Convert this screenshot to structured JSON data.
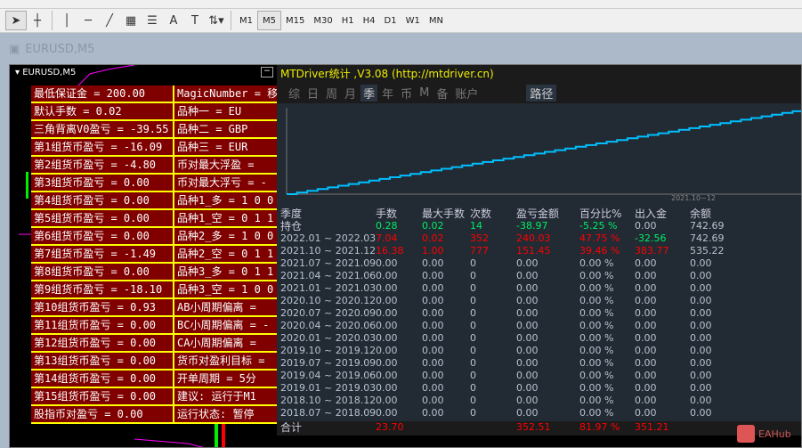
{
  "toolbar": {
    "timeframes": [
      "M1",
      "M5",
      "M15",
      "M30",
      "H1",
      "H4",
      "D1",
      "W1",
      "MN"
    ],
    "active_tf": "M5"
  },
  "window": {
    "title": "EURUSD,M5"
  },
  "chart": {
    "symbol": "EURUSD,M5",
    "minimize": "−"
  },
  "panel": {
    "left": [
      "最低保证金   =  200.00",
      "  默认手数       =  0.02",
      "三角背离V0盈亏 = -39.55",
      "第1组货币盈亏 =  -16.09",
      "第2组货币盈亏 =  -4.80",
      " 第3组货币盈亏 =  0.00",
      " 第4组货币盈亏 =  0.00",
      " 第5组货币盈亏 =  0.00",
      " 第6组货币盈亏 =  0.00",
      "第7组货币盈亏 =  -1.49",
      " 第8组货币盈亏 =  0.00",
      "第9组货币盈亏 =  -18.10",
      " 第10组货币盈亏 = 0.93",
      " 第11组货币盈亏 = 0.00",
      " 第12组货币盈亏 = 0.00",
      " 第13组货币盈亏 = 0.00",
      " 第14组货币盈亏 = 0.00",
      " 第15组货币盈亏 = 0.00",
      "  股指币对盈亏 = 0.00"
    ],
    "right": [
      "MagicNumber = 移",
      "  品种一 =   EU",
      "  品种二 =   GBP",
      "  品种三 =   EUR",
      " 币对最大浮盈 = ",
      " 币对最大浮亏 = -",
      " 品种1_多 = 1 0 0",
      " 品种1_空 = 0 1 1",
      " 品种2_多 = 1 0 0",
      " 品种2_空 = 0 1 1",
      " 品种3_多 = 0 1 1",
      " 品种3_空 = 1 0 0",
      "  AB小周期偏离 = ",
      "  BC小周期偏离 = -",
      "  CA小周期偏离 = ",
      "货币对盈利目标 = ",
      "   开单周期 =  5分",
      "   建议: 运行于M1",
      "  运行状态: 暂停"
    ]
  },
  "stats": {
    "title": "MTDriver统计 ,V3.08 (http://mtdriver.cn)",
    "tabs": [
      "综",
      "日",
      "周",
      "月",
      "季",
      "年",
      "币",
      "M",
      "备",
      "账户"
    ],
    "active_tab": "季",
    "path": "路径",
    "equity_date": "2021.10~12",
    "headers": [
      "季度",
      "手数",
      "最大手数",
      "次数",
      "盈亏金额",
      "百分比%",
      "出入金",
      "余额"
    ],
    "rows": [
      {
        "c": [
          "持仓",
          "0.28",
          "0.02",
          "14",
          "-38.97",
          "-5.25 %",
          "0.00",
          "742.69"
        ],
        "k": [
          "",
          "g",
          "g",
          "g",
          "g",
          "g",
          "",
          ""
        ]
      },
      {
        "c": [
          "2022.01 ~ 2022.03",
          "7.04",
          "0.02",
          "352",
          "240.03",
          "47.75 %",
          "-32.56",
          "742.69"
        ],
        "k": [
          "",
          "r",
          "r",
          "r",
          "r",
          "r",
          "g",
          ""
        ]
      },
      {
        "c": [
          "2021.10 ~ 2021.12",
          "16.38",
          "1.00",
          "777",
          "151.45",
          "39.46 %",
          "383.77",
          "535.22"
        ],
        "k": [
          "",
          "r",
          "r",
          "r",
          "r",
          "r",
          "r",
          ""
        ]
      },
      {
        "c": [
          "2021.07 ~ 2021.09",
          "0.00",
          "0.00",
          "0",
          "0.00",
          "0.00 %",
          "0.00",
          "0.00"
        ]
      },
      {
        "c": [
          "2021.04 ~ 2021.06",
          "0.00",
          "0.00",
          "0",
          "0.00",
          "0.00 %",
          "0.00",
          "0.00"
        ]
      },
      {
        "c": [
          "2021.01 ~ 2021.03",
          "0.00",
          "0.00",
          "0",
          "0.00",
          "0.00 %",
          "0.00",
          "0.00"
        ]
      },
      {
        "c": [
          "2020.10 ~ 2020.12",
          "0.00",
          "0.00",
          "0",
          "0.00",
          "0.00 %",
          "0.00",
          "0.00"
        ]
      },
      {
        "c": [
          "2020.07 ~ 2020.09",
          "0.00",
          "0.00",
          "0",
          "0.00",
          "0.00 %",
          "0.00",
          "0.00"
        ]
      },
      {
        "c": [
          "2020.04 ~ 2020.06",
          "0.00",
          "0.00",
          "0",
          "0.00",
          "0.00 %",
          "0.00",
          "0.00"
        ]
      },
      {
        "c": [
          "2020.01 ~ 2020.03",
          "0.00",
          "0.00",
          "0",
          "0.00",
          "0.00 %",
          "0.00",
          "0.00"
        ]
      },
      {
        "c": [
          "2019.10 ~ 2019.12",
          "0.00",
          "0.00",
          "0",
          "0.00",
          "0.00 %",
          "0.00",
          "0.00"
        ]
      },
      {
        "c": [
          "2019.07 ~ 2019.09",
          "0.00",
          "0.00",
          "0",
          "0.00",
          "0.00 %",
          "0.00",
          "0.00"
        ]
      },
      {
        "c": [
          "2019.04 ~ 2019.06",
          "0.00",
          "0.00",
          "0",
          "0.00",
          "0.00 %",
          "0.00",
          "0.00"
        ]
      },
      {
        "c": [
          "2019.01 ~ 2019.03",
          "0.00",
          "0.00",
          "0",
          "0.00",
          "0.00 %",
          "0.00",
          "0.00"
        ]
      },
      {
        "c": [
          "2018.10 ~ 2018.12",
          "0.00",
          "0.00",
          "0",
          "0.00",
          "0.00 %",
          "0.00",
          "0.00"
        ]
      },
      {
        "c": [
          "2018.07 ~ 2018.09",
          "0.00",
          "0.00",
          "0",
          "0.00",
          "0.00 %",
          "0.00",
          "0.00"
        ]
      }
    ],
    "total": {
      "c": [
        "合计",
        "23.70",
        "",
        "",
        "352.51",
        "81.97 %",
        "351.21",
        ""
      ]
    },
    "colors": {
      "line": "#00bfff",
      "pos": "#ff0000",
      "neg": "#00ee66"
    }
  },
  "watermark": "EAHub"
}
